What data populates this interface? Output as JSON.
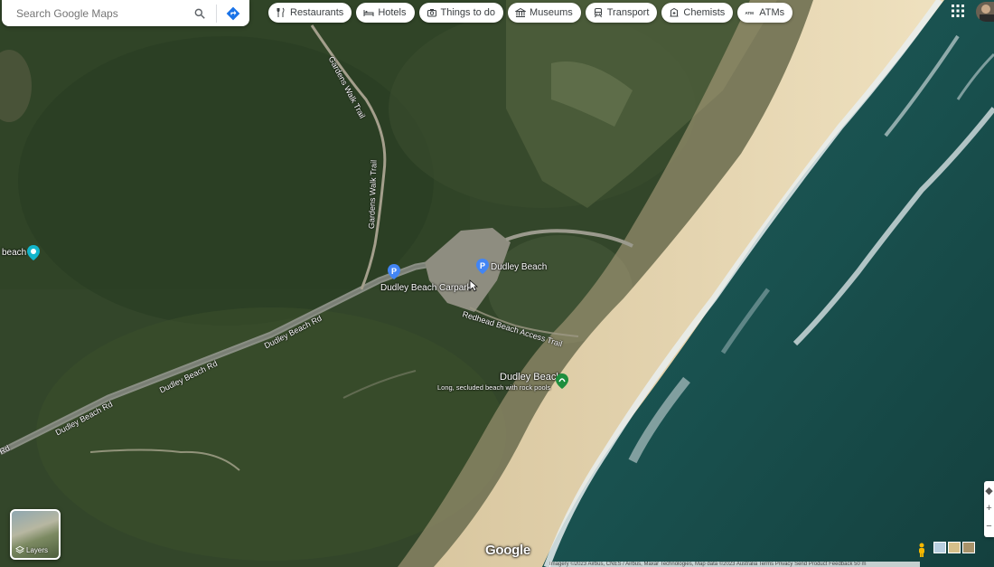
{
  "search": {
    "placeholder": "Search Google Maps"
  },
  "icons": {
    "search": "search-icon",
    "directions": "directions-icon",
    "apps": "apps-grid-icon",
    "layers": "layers-icon",
    "pegman": "pegman-icon"
  },
  "chips": [
    {
      "label": "Restaurants",
      "icon": "restaurant-icon"
    },
    {
      "label": "Hotels",
      "icon": "hotel-icon"
    },
    {
      "label": "Things to do",
      "icon": "camera-icon"
    },
    {
      "label": "Museums",
      "icon": "museum-icon"
    },
    {
      "label": "Transport",
      "icon": "transport-icon"
    },
    {
      "label": "Chemists",
      "icon": "pharmacy-icon"
    },
    {
      "label": "ATMs",
      "icon": "atm-icon"
    }
  ],
  "map_labels": {
    "beach_left": "beach",
    "carpark": "Dudley Beach Carpark",
    "dudley_beach_parking": "Dudley Beach",
    "road1": "Dudley Beach Rd",
    "road2": "Dudley Beach Rd",
    "road3": "Dudley Beach Rd",
    "road4": "Rd",
    "access_trail": "Redhead Beach Access Trail",
    "gardens_trail_top": "Gardens Walk Trail",
    "gardens_trail_mid": "Gardens Walk Trail",
    "poi_name": "Dudley Beach",
    "poi_desc": "Long, secluded beach with rock pools"
  },
  "layers": {
    "label": "Layers"
  },
  "branding": {
    "logo": "Google"
  },
  "attribution": "Imagery ©2023 Airbus, CNES / Airbus, Maxar Technologies, Map data ©2023   Australia   Terms   Privacy   Send Product Feedback   50 m",
  "colors": {
    "poi_green": "#1e8e3e",
    "parking_blue": "#4285f4",
    "teal_poi": "#12b5cb"
  }
}
